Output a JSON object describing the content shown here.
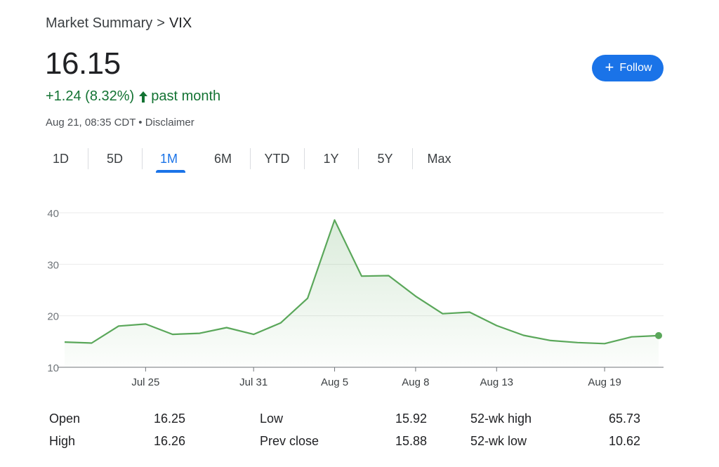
{
  "header": {
    "breadcrumb_root": "Market Summary",
    "breadcrumb_sep": ">",
    "symbol": "VIX",
    "price": "16.15",
    "change": "+1.24 (8.32%)",
    "change_period": "past month",
    "timestamp": "Aug 21, 08:35 CDT",
    "disclaimer": "Disclaimer",
    "follow_label": "Follow"
  },
  "colors": {
    "positive": "#137333",
    "accent": "#1a73e8",
    "line": "#5aa75a"
  },
  "tabs": [
    "1D",
    "5D",
    "1M",
    "6M",
    "YTD",
    "1Y",
    "5Y",
    "Max"
  ],
  "active_tab": "1M",
  "chart_data": {
    "type": "area",
    "x": [
      "Jul 22",
      "Jul 23",
      "Jul 24",
      "Jul 25",
      "Jul 26",
      "Jul 29",
      "Jul 30",
      "Jul 31",
      "Aug 1",
      "Aug 2",
      "Aug 5",
      "Aug 6",
      "Aug 7",
      "Aug 8",
      "Aug 9",
      "Aug 12",
      "Aug 13",
      "Aug 14",
      "Aug 15",
      "Aug 16",
      "Aug 19",
      "Aug 20",
      "Aug 21"
    ],
    "series": [
      {
        "values": [
          14.9,
          14.7,
          18.0,
          18.4,
          16.4,
          16.6,
          17.7,
          16.4,
          18.6,
          23.4,
          38.6,
          27.7,
          27.8,
          23.8,
          20.4,
          20.7,
          18.1,
          16.2,
          15.2,
          14.8,
          14.6,
          15.9,
          16.15
        ]
      }
    ],
    "x_ticks": [
      "Jul 25",
      "Jul 31",
      "Aug 5",
      "Aug 8",
      "Aug 13",
      "Aug 19"
    ],
    "y_ticks": [
      10,
      20,
      30,
      40
    ],
    "ylim": [
      10,
      40
    ],
    "grid": true
  },
  "stats": [
    [
      {
        "label": "Open",
        "value": "16.25"
      },
      {
        "label": "Low",
        "value": "15.92"
      },
      {
        "label": "52-wk high",
        "value": "65.73"
      }
    ],
    [
      {
        "label": "High",
        "value": "16.26"
      },
      {
        "label": "Prev close",
        "value": "15.88"
      },
      {
        "label": "52-wk low",
        "value": "10.62"
      }
    ]
  ]
}
